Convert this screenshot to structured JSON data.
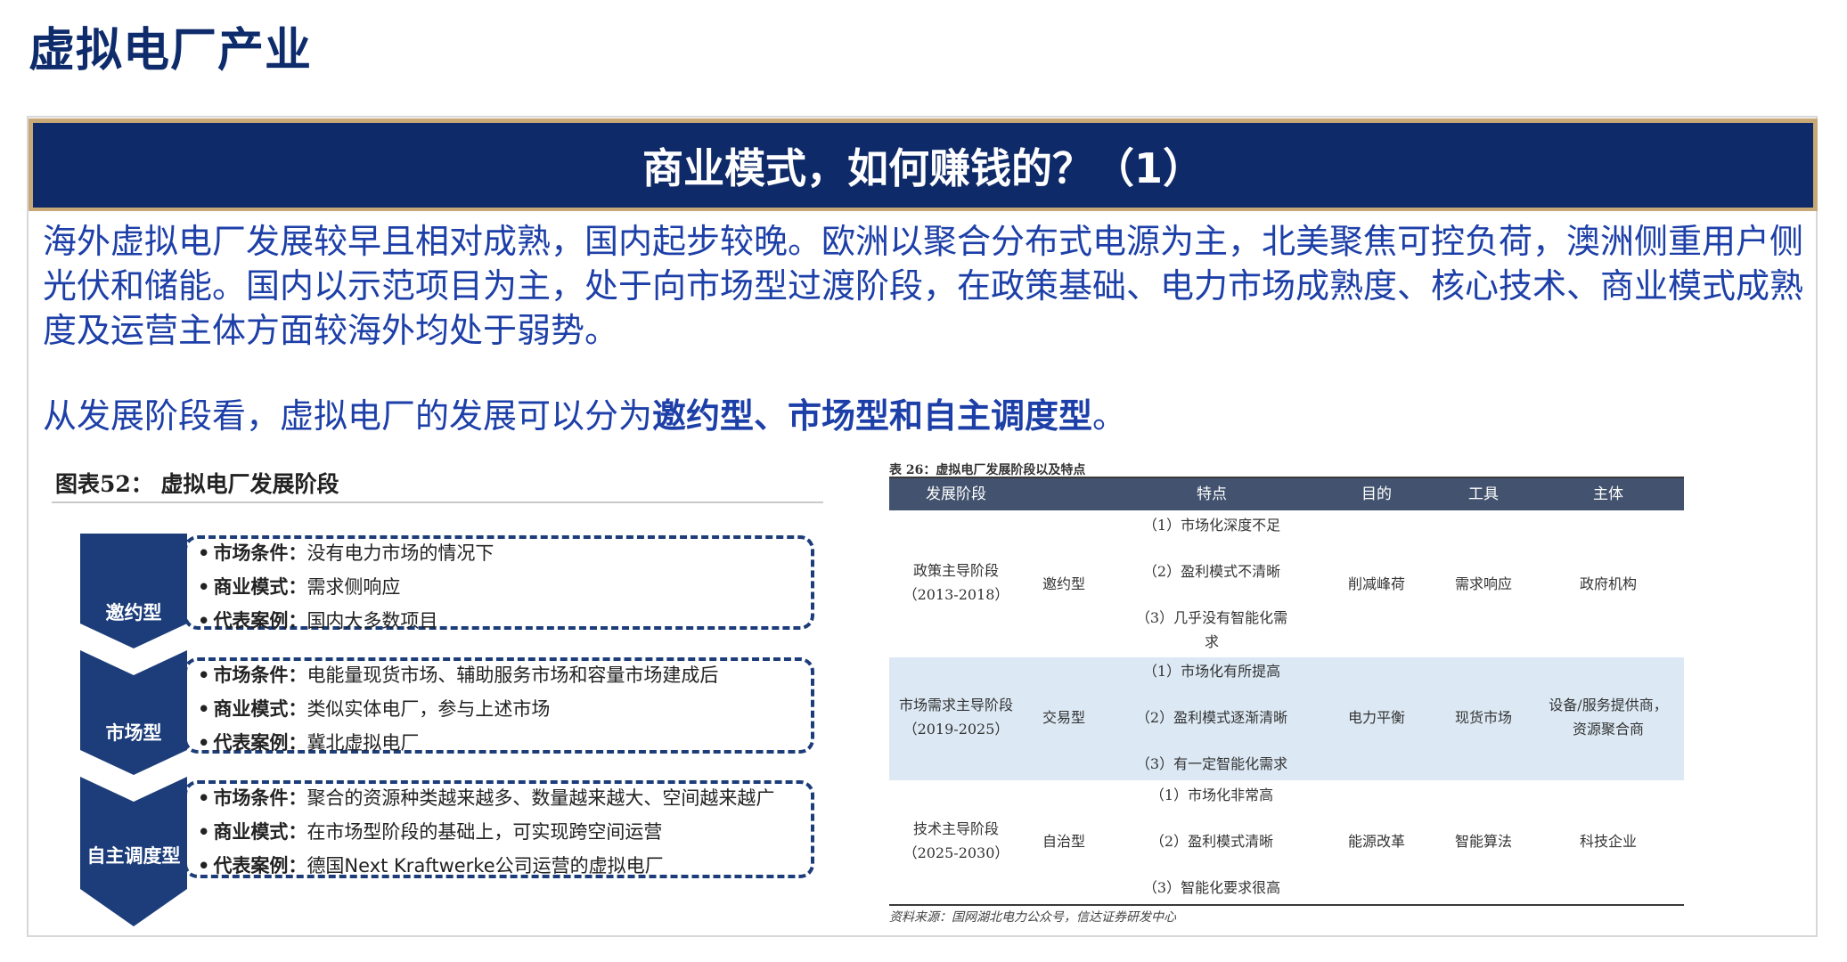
{
  "page": {
    "title": "虚拟电厂产业"
  },
  "banner": {
    "text": "商业模式，如何赚钱的？（1）"
  },
  "intro": {
    "p1": "海外虚拟电厂发展较早且相对成熟，国内起步较晚。欧洲以聚合分布式电源为主，北美聚焦可控负荷，澳洲侧重用户侧光伏和储能。国内以示范项目为主，处于向市场型过渡阶段，在政策基础、电力市场成熟度、核心技术、商业模式成熟度及运营主体方面较海外均处于弱势。",
    "p2_prefix": "从发展阶段看，虚拟电厂的发展可以分为",
    "p2_bold": "邀约型、市场型和自主调度型",
    "p2_suffix": "。"
  },
  "figure": {
    "title": "图表52：  虚拟电厂发展阶段",
    "stages": [
      {
        "label": "邀约型",
        "bullets": [
          {
            "key": "市场条件：",
            "value": "没有电力市场的情况下"
          },
          {
            "key": "商业模式：",
            "value": "需求侧响应"
          },
          {
            "key": "代表案例：",
            "value": "国内大多数项目"
          }
        ]
      },
      {
        "label": "市场型",
        "bullets": [
          {
            "key": "市场条件：",
            "value": "电能量现货市场、辅助服务市场和容量市场建成后"
          },
          {
            "key": "商业模式：",
            "value": "类似实体电厂，参与上述市场"
          },
          {
            "key": "代表案例：",
            "value": "冀北虚拟电厂"
          }
        ]
      },
      {
        "label": "自主调度型",
        "bullets": [
          {
            "key": "市场条件：",
            "value": "聚合的资源种类越来越多、数量越来越大、空间越来越广"
          },
          {
            "key": "商业模式：",
            "value": "在市场型阶段的基础上，可实现跨空间运营"
          },
          {
            "key": "代表案例：",
            "value": "德国Next Kraftwerke公司运营的虚拟电厂"
          }
        ]
      }
    ],
    "colors": {
      "chevron": "#1c3d7a",
      "dash": "#1c3d7a"
    }
  },
  "table": {
    "caption": "表 26：虚拟电厂发展阶段以及特点",
    "headers": [
      "发展阶段",
      "特点",
      "目的",
      "工具",
      "主体"
    ],
    "rows": [
      {
        "stage": "政策主导阶段",
        "period": "（2013-2018）",
        "type": "邀约型",
        "features": [
          "（1）市场化深度不足",
          "（2）盈利模式不清晰",
          "（3）几乎没有智能化需",
          "求"
        ],
        "purpose": "削减峰荷",
        "tool": "需求响应",
        "subject": [
          "政府机构"
        ]
      },
      {
        "stage": "市场需求主导阶段",
        "period": "（2019-2025）",
        "type": "交易型",
        "features": [
          "（1）市场化有所提高",
          "（2）盈利模式逐渐清晰",
          "（3）有一定智能化需求"
        ],
        "purpose": "电力平衡",
        "tool": "现货市场",
        "subject": [
          "设备/服务提供商，",
          "资源聚合商"
        ]
      },
      {
        "stage": "技术主导阶段",
        "period": "（2025-2030）",
        "type": "自治型",
        "features": [
          "（1）市场化非常高",
          "（2）盈利模式清晰",
          "（3）智能化要求很高"
        ],
        "purpose": "能源改革",
        "tool": "智能算法",
        "subject": [
          "科技企业"
        ]
      }
    ],
    "source": "资料来源：国网湖北电力公众号，信达证券研发中心",
    "colors": {
      "header_bg": "#43536f",
      "alt_row": "#dce9f4"
    }
  }
}
